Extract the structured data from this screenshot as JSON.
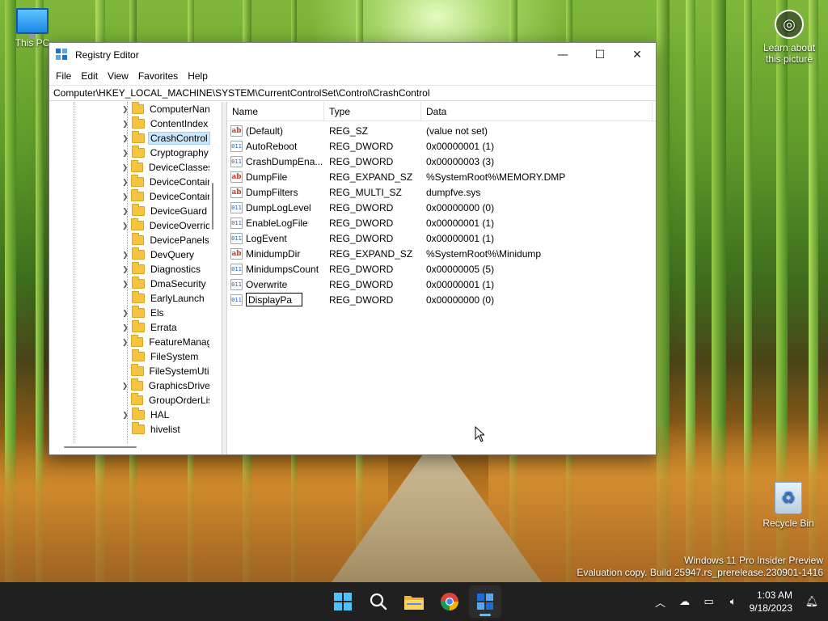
{
  "desktop": {
    "icons": {
      "this_pc": "This PC",
      "learn": "Learn about this picture",
      "recycle": "Recycle Bin"
    },
    "watermark": {
      "line1": "Windows 11 Pro Insider Preview",
      "line2": "Evaluation copy. Build 25947.rs_prerelease.230901-1416"
    }
  },
  "window": {
    "title": "Registry Editor",
    "controls": {
      "minimize": "—",
      "maximize": "☐",
      "close": "✕"
    },
    "menu": [
      "File",
      "Edit",
      "View",
      "Favorites",
      "Help"
    ],
    "address": "Computer\\HKEY_LOCAL_MACHINE\\SYSTEM\\CurrentControlSet\\Control\\CrashControl",
    "tree": {
      "items": [
        {
          "label": "ComputerNan",
          "expandable": true
        },
        {
          "label": "ContentIndex",
          "expandable": true
        },
        {
          "label": "CrashControl",
          "expandable": true,
          "selected": true
        },
        {
          "label": "Cryptography",
          "expandable": true
        },
        {
          "label": "DeviceClasses",
          "expandable": true
        },
        {
          "label": "DeviceContair",
          "expandable": true
        },
        {
          "label": "DeviceContair",
          "expandable": true
        },
        {
          "label": "DeviceGuard",
          "expandable": true
        },
        {
          "label": "DeviceOverrid",
          "expandable": true
        },
        {
          "label": "DevicePanels",
          "expandable": false
        },
        {
          "label": "DevQuery",
          "expandable": true
        },
        {
          "label": "Diagnostics",
          "expandable": true
        },
        {
          "label": "DmaSecurity",
          "expandable": true
        },
        {
          "label": "EarlyLaunch",
          "expandable": false
        },
        {
          "label": "Els",
          "expandable": true
        },
        {
          "label": "Errata",
          "expandable": true
        },
        {
          "label": "FeatureManag",
          "expandable": true
        },
        {
          "label": "FileSystem",
          "expandable": false
        },
        {
          "label": "FileSystemUtil",
          "expandable": false
        },
        {
          "label": "GraphicsDriver",
          "expandable": true
        },
        {
          "label": "GroupOrderLis",
          "expandable": false
        },
        {
          "label": "HAL",
          "expandable": true
        },
        {
          "label": "hivelist",
          "expandable": false
        }
      ]
    },
    "list": {
      "headers": {
        "name": "Name",
        "type": "Type",
        "data": "Data"
      },
      "rows": [
        {
          "name": "(Default)",
          "type": "REG_SZ",
          "data": "(value not set)",
          "kind": "sz"
        },
        {
          "name": "AutoReboot",
          "type": "REG_DWORD",
          "data": "0x00000001 (1)",
          "kind": "bin"
        },
        {
          "name": "CrashDumpEna...",
          "type": "REG_DWORD",
          "data": "0x00000003 (3)",
          "kind": "bin"
        },
        {
          "name": "DumpFile",
          "type": "REG_EXPAND_SZ",
          "data": "%SystemRoot%\\MEMORY.DMP",
          "kind": "sz"
        },
        {
          "name": "DumpFilters",
          "type": "REG_MULTI_SZ",
          "data": "dumpfve.sys",
          "kind": "sz"
        },
        {
          "name": "DumpLogLevel",
          "type": "REG_DWORD",
          "data": "0x00000000 (0)",
          "kind": "bin"
        },
        {
          "name": "EnableLogFile",
          "type": "REG_DWORD",
          "data": "0x00000001 (1)",
          "kind": "bin"
        },
        {
          "name": "LogEvent",
          "type": "REG_DWORD",
          "data": "0x00000001 (1)",
          "kind": "bin"
        },
        {
          "name": "MinidumpDir",
          "type": "REG_EXPAND_SZ",
          "data": "%SystemRoot%\\Minidump",
          "kind": "sz"
        },
        {
          "name": "MinidumpsCount",
          "type": "REG_DWORD",
          "data": "0x00000005 (5)",
          "kind": "bin"
        },
        {
          "name": "Overwrite",
          "type": "REG_DWORD",
          "data": "0x00000001 (1)",
          "kind": "bin"
        }
      ],
      "editing_row": {
        "name_value": "DisplayPa",
        "type": "REG_DWORD",
        "data": "0x00000000 (0)",
        "kind": "bin"
      }
    }
  },
  "taskbar": {
    "apps": [
      "start-icon",
      "search-icon",
      "file-explorer-icon",
      "chrome-icon",
      "registry-editor-icon"
    ],
    "clock": {
      "time": "1:03 AM",
      "date": "9/18/2023"
    },
    "colors": {
      "accent": "#4cc2ff",
      "bar": "#202020"
    }
  }
}
